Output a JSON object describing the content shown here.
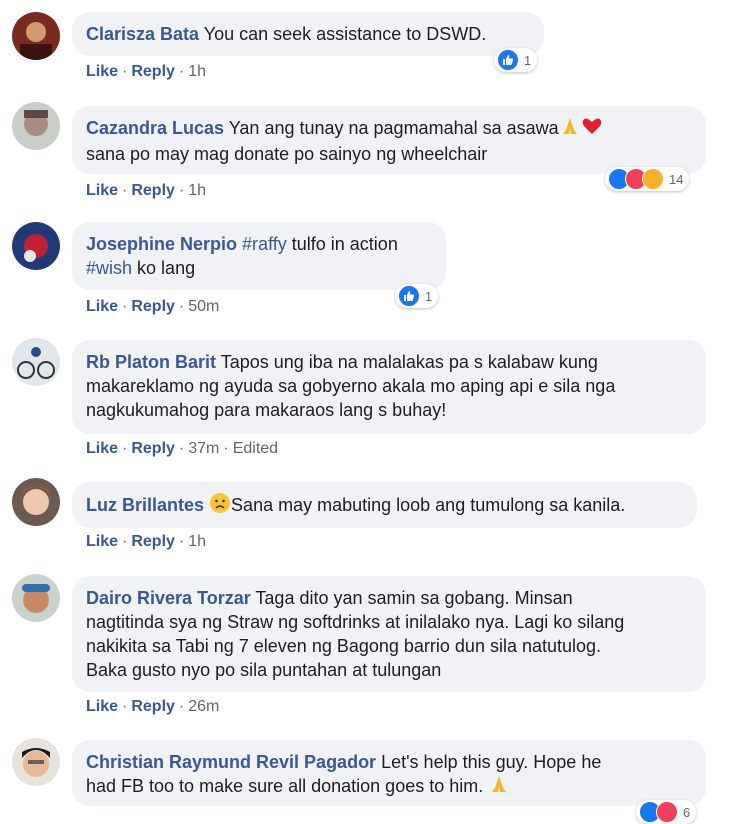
{
  "actions": {
    "like": "Like",
    "reply": "Reply",
    "dot": "·"
  },
  "comments": [
    {
      "author": "Clarisza Bata",
      "text": "You can seek assistance to DSWD.",
      "time": "1h",
      "reactions": "1"
    },
    {
      "author": "Cazandra Lucas",
      "text_line1": "Yan ang tunay na pagmamahal sa asawa",
      "text_line2": "sana po may mag donate po sainyo ng wheelchair",
      "time": "1h",
      "reactions": "14"
    },
    {
      "author": "Josephine Nerpio",
      "hashtag1": "#raffy",
      "text_a": "tulfo in action",
      "hashtag2": "#wish",
      "text_b": "ko lang",
      "time": "50m",
      "reactions": "1"
    },
    {
      "author": "Rb Platon Barit",
      "text_line1": "Tapos ung iba na malalakas pa s kalabaw kung",
      "text_line2": "makareklamo ng ayuda sa gobyerno akala mo aping api e sila nga",
      "text_line3": "nagkukumahog para makaraos lang s buhay!",
      "time": "37m",
      "edited": "Edited"
    },
    {
      "author": "Luz Brillantes",
      "text": "Sana may mabuting loob ang tumulong sa kanila.",
      "time": "1h"
    },
    {
      "author": "Dairo Rivera Torzar",
      "text_line1": "Taga dito yan samin sa gobang. Minsan",
      "text_line2": "nagtitinda sya ng Straw ng softdrinks at inilalako nya. Lagi ko silang",
      "text_line3": "nakikita sa Tabi ng 7 eleven ng Bagong barrio dun sila natutulog.",
      "text_line4": "Baka gusto nyo po sila puntahan at tulungan",
      "time": "26m"
    },
    {
      "author": "Christian Raymund Revil Pagador",
      "text_line1": "Let's help this guy. Hope he",
      "text_line2": "had FB too to make sure all donation goes to him.",
      "reactions": "6"
    }
  ],
  "colors": {
    "link": "#385898",
    "bubble": "#f0f2f5",
    "like": "#1877f2",
    "love": "#f33e58",
    "care": "#f7b125"
  }
}
